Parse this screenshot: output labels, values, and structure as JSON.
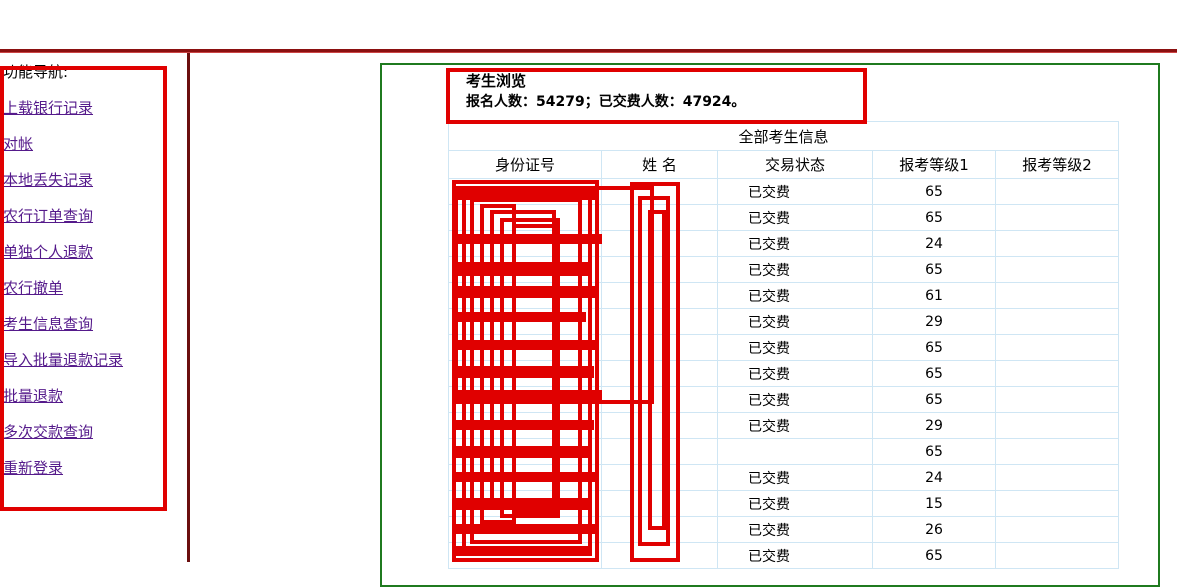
{
  "sidebar": {
    "title": "功能导航:",
    "links": [
      "上载银行记录",
      "对帐",
      "本地丢失记录",
      "农行订单查询",
      "单独个人退款",
      "农行撤单",
      "考生信息查询",
      "导入批量退款记录",
      "批量退款",
      "多次交款查询",
      "重新登录"
    ]
  },
  "main": {
    "title": "考生浏览",
    "stats": "报名人数：54279；已交费人数：47924。",
    "table_caption": "全部考生信息",
    "columns": [
      "身份证号",
      "姓 名",
      "交易状态",
      "报考等级1",
      "报考等级2"
    ],
    "rows": [
      {
        "status": "已交费",
        "level1": "65",
        "level2": ""
      },
      {
        "status": "已交费",
        "level1": "65",
        "level2": ""
      },
      {
        "status": "已交费",
        "level1": "24",
        "level2": ""
      },
      {
        "status": "已交费",
        "level1": "65",
        "level2": ""
      },
      {
        "status": "已交费",
        "level1": "61",
        "level2": ""
      },
      {
        "status": "已交费",
        "level1": "29",
        "level2": ""
      },
      {
        "status": "已交费",
        "level1": "65",
        "level2": ""
      },
      {
        "status": "已交费",
        "level1": "65",
        "level2": ""
      },
      {
        "status": "已交费",
        "level1": "65",
        "level2": ""
      },
      {
        "status": "已交费",
        "level1": "29",
        "level2": ""
      },
      {
        "status": "",
        "level1": "65",
        "level2": ""
      },
      {
        "status": "已交费",
        "level1": "24",
        "level2": ""
      },
      {
        "status": "已交费",
        "level1": "15",
        "level2": ""
      },
      {
        "status": "已交费",
        "level1": "26",
        "level2": ""
      },
      {
        "status": "已交费",
        "level1": "65",
        "level2": ""
      }
    ]
  },
  "colors": {
    "redaction": "#e00000",
    "frame": "#1f7a1f",
    "divider": "#8b1010",
    "link": "#551a8b",
    "grid": "#cfe6f4"
  }
}
